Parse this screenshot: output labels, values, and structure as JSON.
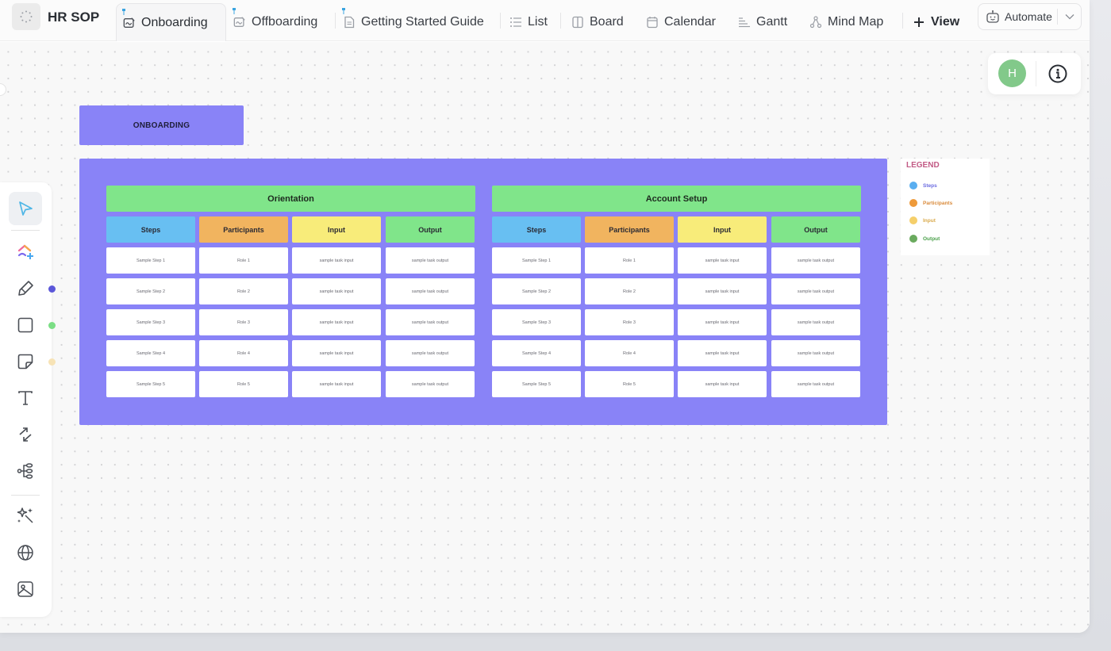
{
  "header": {
    "space_title": "HR SOP",
    "tabs": [
      {
        "label": "Onboarding",
        "icon": "whiteboard-icon",
        "pinned": true,
        "active": true
      },
      {
        "label": "Offboarding",
        "icon": "whiteboard-icon",
        "pinned": true,
        "active": false
      },
      {
        "label": "Getting Started Guide",
        "icon": "doc-icon",
        "pinned": true,
        "active": false
      },
      {
        "label": "List",
        "icon": "list-icon",
        "pinned": false,
        "active": false
      },
      {
        "label": "Board",
        "icon": "board-icon",
        "pinned": false,
        "active": false
      },
      {
        "label": "Calendar",
        "icon": "calendar-icon",
        "pinned": false,
        "active": false
      },
      {
        "label": "Gantt",
        "icon": "gantt-icon",
        "pinned": false,
        "active": false
      },
      {
        "label": "Mind Map",
        "icon": "mindmap-icon",
        "pinned": false,
        "active": false
      }
    ],
    "add_view_label": "View",
    "automate_label": "Automate"
  },
  "user_panel": {
    "avatar_initial": "H",
    "avatar_color": "#82c98a"
  },
  "toolbar": {
    "tools": [
      {
        "name": "select-tool",
        "icon": "cursor-icon"
      },
      {
        "name": "clickup-ai-tool",
        "icon": "clickup-plus-icon"
      },
      {
        "name": "pen-tool",
        "icon": "pen-icon"
      },
      {
        "name": "shape-tool",
        "icon": "square-icon"
      },
      {
        "name": "sticky-note-tool",
        "icon": "sticky-note-icon"
      },
      {
        "name": "text-tool",
        "icon": "text-icon"
      },
      {
        "name": "connector-tool",
        "icon": "connector-arrows-icon"
      },
      {
        "name": "mindmap-tool",
        "icon": "mindmap-icon"
      },
      {
        "name": "ai-magic-tool",
        "icon": "magic-wand-icon"
      },
      {
        "name": "embed-tool",
        "icon": "globe-icon"
      },
      {
        "name": "image-tool",
        "icon": "image-icon"
      }
    ],
    "tool_colors": {
      "pen": "#5b57d9",
      "shape": "#7bde85",
      "sticky": "#f7e3b6"
    }
  },
  "whiteboard": {
    "title": "ONBOARDING",
    "board_color": "#8983f7",
    "columns": [
      {
        "label": "Steps",
        "color": "#68bff2"
      },
      {
        "label": "Participants",
        "color": "#f1b45f"
      },
      {
        "label": "Input",
        "color": "#f8ec7a"
      },
      {
        "label": "Output",
        "color": "#80e58a"
      }
    ],
    "sections": [
      {
        "title": "Orientation",
        "rows": [
          [
            "Sample Step 1",
            "Role 1",
            "sample task input",
            "sample task output"
          ],
          [
            "Sample Step 2",
            "Role 2",
            "sample task input",
            "sample task output"
          ],
          [
            "Sample Step 3",
            "Role 3",
            "sample task input",
            "sample task output"
          ],
          [
            "Sample Step 4",
            "Role 4",
            "sample task input",
            "sample task output"
          ],
          [
            "Sample Step 5",
            "Role 5",
            "sample task input",
            "sample task output"
          ]
        ]
      },
      {
        "title": "Account Setup",
        "rows": [
          [
            "Sample Step 1",
            "Role 1",
            "sample task input",
            "sample task output"
          ],
          [
            "Sample Step 2",
            "Role 2",
            "sample task input",
            "sample task output"
          ],
          [
            "Sample Step 3",
            "Role 3",
            "sample task input",
            "sample task output"
          ],
          [
            "Sample Step 4",
            "Role 4",
            "sample task input",
            "sample task output"
          ],
          [
            "Sample Step 5",
            "Role 5",
            "sample task input",
            "sample task output"
          ]
        ]
      }
    ]
  },
  "legend": {
    "title": "LEGEND",
    "items": [
      {
        "label": "Steps",
        "dot_color": "#5aaef0",
        "text_color": "#6a6ae0"
      },
      {
        "label": "Participants",
        "dot_color": "#ee9a3a",
        "text_color": "#d98a3a"
      },
      {
        "label": "Input",
        "dot_color": "#f5cf6a",
        "text_color": "#d9a94a"
      },
      {
        "label": "Output",
        "dot_color": "#6aaa5e",
        "text_color": "#4aa04a"
      }
    ]
  }
}
